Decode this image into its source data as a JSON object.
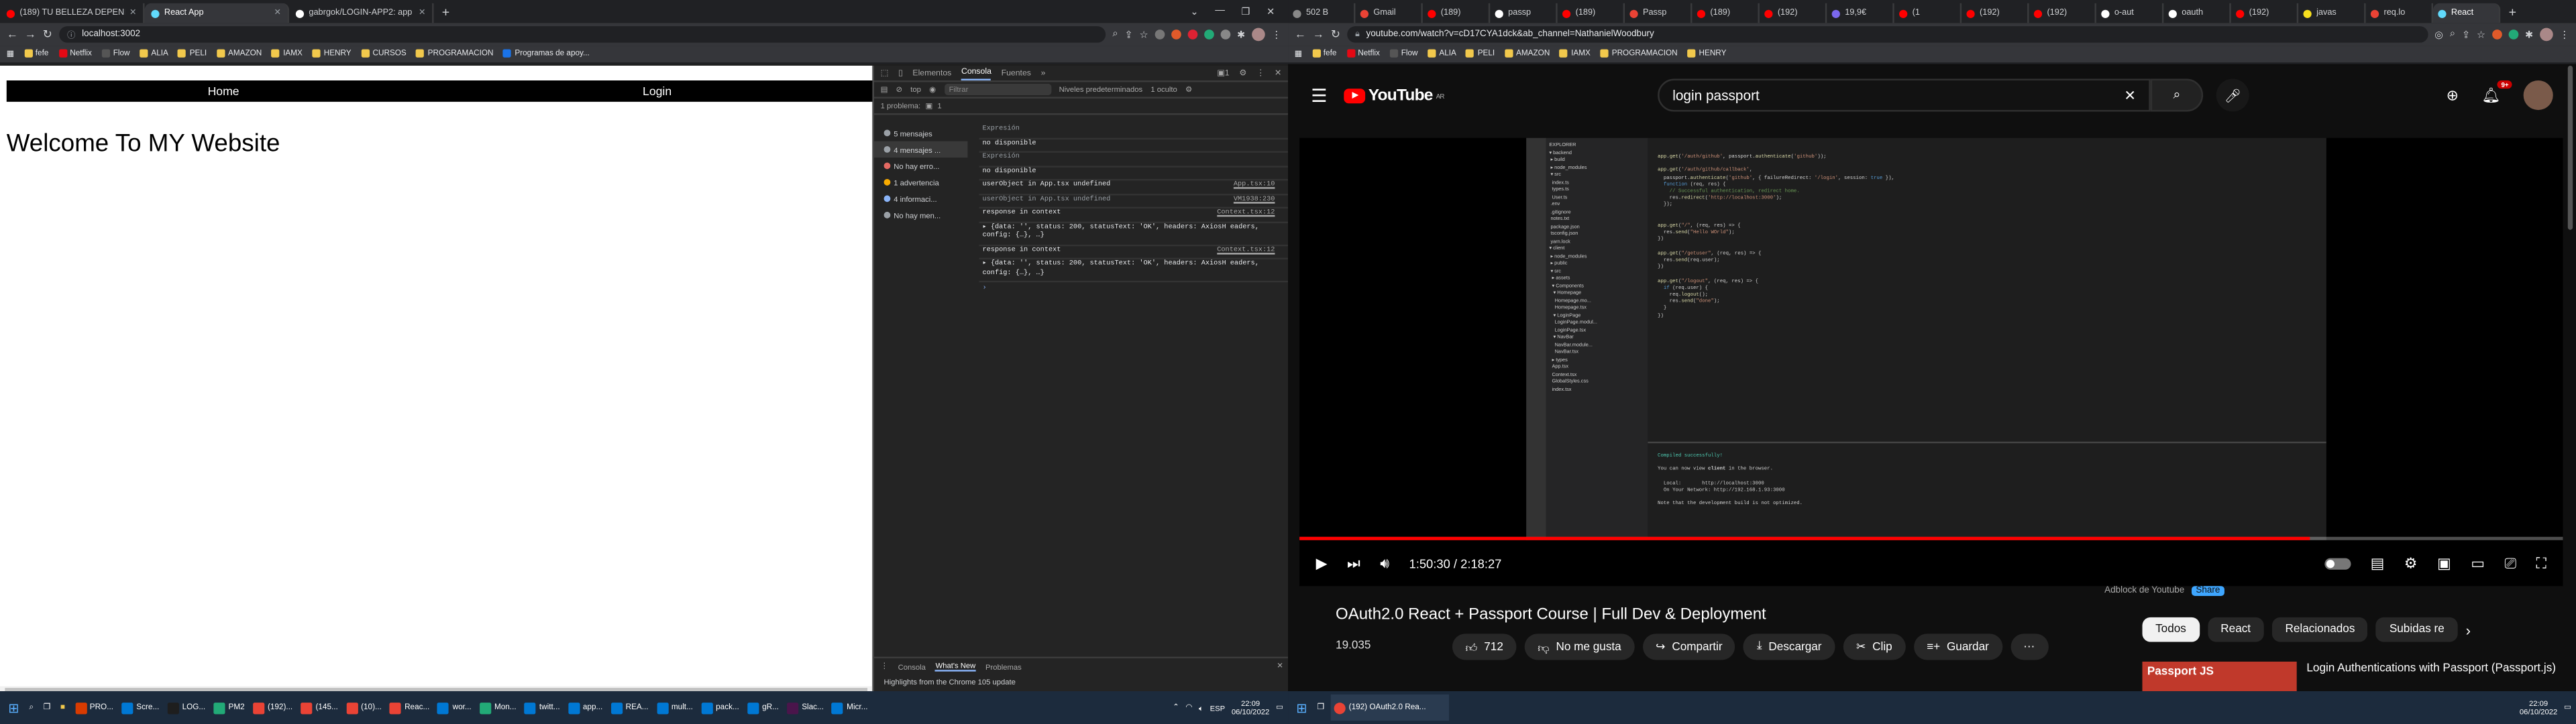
{
  "left": {
    "tabs": [
      {
        "title": "(189) TU BELLEZA DEPENDE DE ...",
        "color": "#ff0000",
        "active": false
      },
      {
        "title": "React App",
        "color": "#61dafb",
        "active": true
      },
      {
        "title": "gabrgok/LOGIN-APP2: app en lo...",
        "color": "#ffffff",
        "active": false
      }
    ],
    "url": "localhost:3002",
    "bookmarks": [
      "fefe",
      "Netflix",
      "Flow",
      "ALIA",
      "PELI",
      "AMAZON",
      "IAMX",
      "HENRY",
      "CURSOS",
      "PROGRAMACION",
      "Programas de apoy..."
    ],
    "site": {
      "nav": [
        "Home",
        "Login"
      ],
      "heading": "Welcome To MY Website"
    },
    "devtools": {
      "tabs": [
        "Elementos",
        "Consola",
        "Fuentes"
      ],
      "context": "top",
      "filter_placeholder": "Filtrar",
      "levels": "Niveles predeterminados",
      "hidden": "1 oculto",
      "problems": "1 problema:",
      "problem_count": "1",
      "sidebar": [
        {
          "label": "5 mensajes",
          "color": "#9aa0a6"
        },
        {
          "label": "4 mensajes ...",
          "color": "#9aa0a6"
        },
        {
          "label": "No hay erro...",
          "color": "#e46962"
        },
        {
          "label": "1 advertencia",
          "color": "#f9ab00"
        },
        {
          "label": "4 informaci...",
          "color": "#8ab4f8"
        },
        {
          "label": "No hay men...",
          "color": "#9aa0a6"
        }
      ],
      "lines": [
        {
          "text": "Expresión",
          "src": "",
          "cls": "grey"
        },
        {
          "text": "no disponible",
          "src": "",
          "cls": ""
        },
        {
          "text": "Expresión",
          "src": "",
          "cls": "grey"
        },
        {
          "text": "no disponible",
          "src": "",
          "cls": ""
        },
        {
          "text": "userObject in App.tsx undefined",
          "src": "App.tsx:10",
          "cls": ""
        },
        {
          "text": "userObject in App.tsx undefined",
          "src": "VM1938:230",
          "cls": "grey"
        },
        {
          "text": "response in context",
          "src": "Context.tsx:12",
          "cls": ""
        },
        {
          "text": "▸ {data: '', status: 200, statusText: 'OK', headers: AxiosH eaders, config: {…}, …}",
          "src": "",
          "cls": ""
        },
        {
          "text": "response in context",
          "src": "Context.tsx:12",
          "cls": ""
        },
        {
          "text": "▸ {data: '', status: 200, statusText: 'OK', headers: AxiosH eaders, config: {…}, …}",
          "src": "",
          "cls": ""
        }
      ],
      "drawer_tabs": [
        "Consola",
        "What's New",
        "Problemas"
      ],
      "drawer_msg": "Highlights from the Chrome 105 update"
    }
  },
  "right": {
    "tabs": [
      "502 B",
      "Gmail",
      "(189)",
      "passp",
      "(189)",
      "Passp",
      "(189)",
      "(192)",
      "19,9€",
      "(1",
      "(192)",
      "(192)",
      "o-aut",
      "oauth",
      "(192)",
      "javas",
      "req.lo",
      "React"
    ],
    "url": "youtube.com/watch?v=cD17CYA1dck&ab_channel=NathanielWoodbury",
    "bookmarks": [
      "fefe",
      "Netflix",
      "Flow",
      "ALIA",
      "PELI",
      "AMAZON",
      "IAMX",
      "PROGRAMACION",
      "HENRY"
    ],
    "yt": {
      "logo": "YouTube",
      "country": "AR",
      "search": "login passport",
      "notif_count": "9+",
      "time": "1:50:30 / 2:18:27",
      "progress": 0.8,
      "title": "OAuth2.0 React + Passport Course | Full Dev & Deployment",
      "views": "19.035",
      "likes": "712",
      "dislike": "No me gusta",
      "share": "Compartir",
      "download": "Descargar",
      "clip": "Clip",
      "save": "Guardar",
      "adblock": "Adblock de Youtube",
      "adblock_share": "Share",
      "chips": [
        "Todos",
        "React",
        "Relacionados",
        "Subidas re"
      ],
      "rec_thumb": "Passport JS",
      "rec_title": "Login Authentications with Passport (Passport.js)"
    }
  },
  "taskbar": {
    "left_items": [
      "PRO...",
      "Scre...",
      "LOG...",
      "PM2",
      "(192)...",
      "(145...",
      "(10)...",
      "Reac...",
      "wor...",
      "Mon...",
      "twitt...",
      "app...",
      "REA...",
      "mult...",
      "pack...",
      "gR...",
      "Slac...",
      "Micr..."
    ],
    "lang": "ESP",
    "time": "22:09",
    "date": "06/10/2022",
    "right_item": "(192) OAuth2.0 Rea...",
    "right_time": "22:09",
    "right_date": "06/10/2022"
  }
}
